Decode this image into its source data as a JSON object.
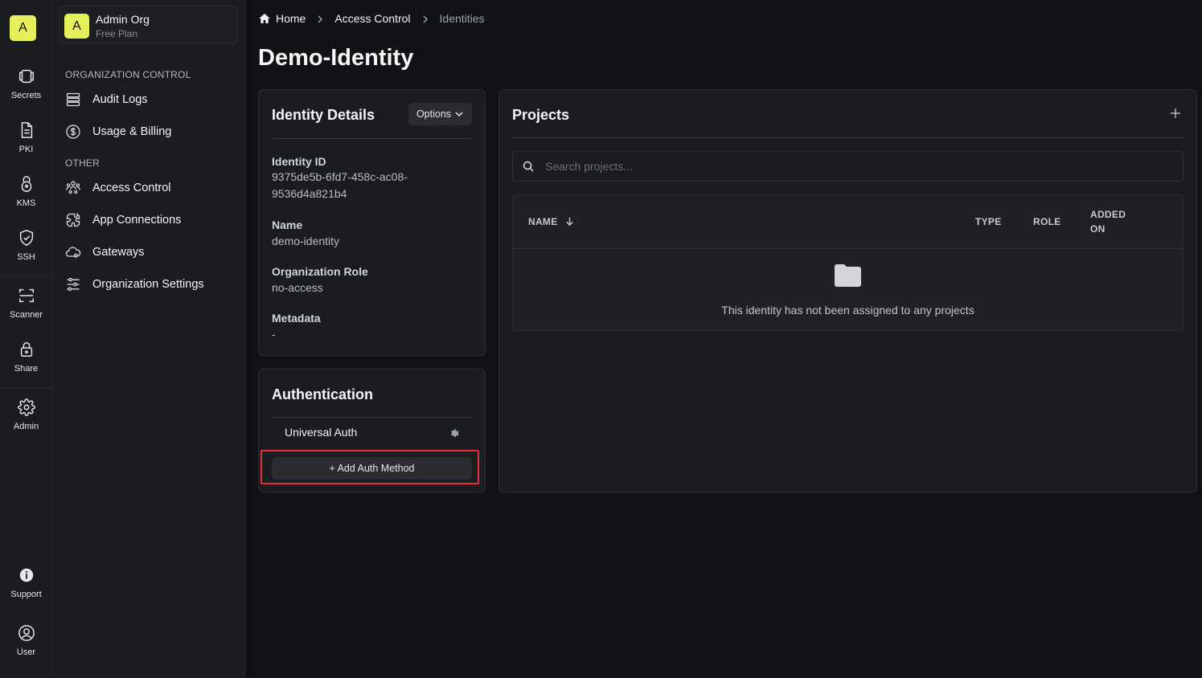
{
  "rail": {
    "logo": "A",
    "items": [
      {
        "label": "Secrets",
        "icon": "secrets-icon"
      },
      {
        "label": "PKI",
        "icon": "pki-icon"
      },
      {
        "label": "KMS",
        "icon": "kms-icon"
      },
      {
        "label": "SSH",
        "icon": "ssh-icon"
      },
      {
        "label": "Scanner",
        "icon": "scanner-icon"
      },
      {
        "label": "Share",
        "icon": "lock-icon"
      },
      {
        "label": "Admin",
        "icon": "gear-icon"
      },
      {
        "label": "Support",
        "icon": "info-icon"
      },
      {
        "label": "User",
        "icon": "user-icon"
      }
    ]
  },
  "org": {
    "avatar": "A",
    "name": "Admin Org",
    "plan": "Free Plan"
  },
  "sidebar": {
    "section_org": "ORGANIZATION CONTROL",
    "section_other": "OTHER",
    "items": [
      {
        "label": "Audit Logs",
        "icon": "list-icon"
      },
      {
        "label": "Usage & Billing",
        "icon": "dollar-icon"
      },
      {
        "label": "Access Control",
        "icon": "users-icon"
      },
      {
        "label": "App Connections",
        "icon": "puzzle-icon"
      },
      {
        "label": "Gateways",
        "icon": "cloud-icon"
      },
      {
        "label": "Organization Settings",
        "icon": "sliders-icon"
      }
    ]
  },
  "breadcrumb": {
    "home": "Home",
    "access_control": "Access Control",
    "current": "Identities"
  },
  "page_title": "Demo-Identity",
  "identity_details": {
    "title": "Identity Details",
    "options_label": "Options",
    "id_label": "Identity ID",
    "id_line1": "9375de5b-6fd7-458c-ac08-",
    "id_line2": "9536d4a821b4",
    "name_label": "Name",
    "name_value": "demo-identity",
    "role_label": "Organization Role",
    "role_value": "no-access",
    "metadata_label": "Metadata",
    "metadata_value": "-"
  },
  "authentication": {
    "title": "Authentication",
    "method": "Universal Auth",
    "add_button": "+ Add Auth Method"
  },
  "projects": {
    "title": "Projects",
    "search_placeholder": "Search projects...",
    "columns": {
      "name": "NAME",
      "type": "TYPE",
      "role": "ROLE",
      "added_line1": "ADDED",
      "added_line2": "ON"
    },
    "empty_text": "This identity has not been assigned to any projects"
  },
  "colors": {
    "accent": "#e5f05a",
    "highlight": "#e5303b",
    "background": "#111215"
  }
}
